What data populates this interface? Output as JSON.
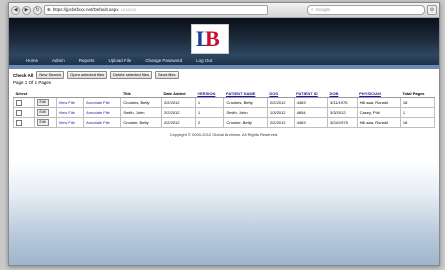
{
  "browser": {
    "url": "https://jpcbkfxxx.net/Default.aspx",
    "url_suffix": "Lexicon",
    "search_placeholder": "Google",
    "nav_back": "◀",
    "nav_forward": "▶",
    "nav_reload": "↻"
  },
  "brand": {
    "logo_letter_1": "L",
    "logo_letter_2": "B"
  },
  "menu": [
    "Home",
    "Admin",
    "Reports",
    "Upload File",
    "Change Password",
    "Log Out"
  ],
  "toolbar": {
    "check_all": "Check All",
    "new_search": "New Search",
    "open_selected": "Open selected files",
    "delete_selected": "Delete selected files",
    "send_files": "Send files"
  },
  "pagination": {
    "page_label": "Page",
    "current": "1",
    "of_label": "Of",
    "total": "1",
    "pages_label": "Pages"
  },
  "table": {
    "columns": [
      "Select",
      "",
      "",
      "",
      "Title",
      "Date Added",
      "VERSION",
      "PATIENT NAME",
      "DOS",
      "PATIENT ID",
      "DOB",
      "PHYSICIAN",
      "Total Pages"
    ],
    "link_columns": [
      6,
      7,
      8,
      9,
      10,
      11
    ],
    "rows": [
      {
        "edit": "Edit",
        "view": "View File",
        "annotate": "Annotate File",
        "title": "Crookes, Betty",
        "date_added": "2/2/2012",
        "version": "1",
        "patient_name": "Crookes, Betty",
        "dos": "2/2/2012",
        "patient_id": "4463",
        "dob": "3/11/1975",
        "physician": "Hill aaa, Ronald",
        "pages": "18"
      },
      {
        "edit": "Edit",
        "view": "View File",
        "annotate": "Annotate File",
        "title": "Smith, John",
        "date_added": "2/2/2012",
        "version": "1",
        "patient_name": "Smith, John",
        "dos": "1/3/2012",
        "patient_id": "4654",
        "dob": "3/3/2012",
        "physician": "Casey, Phil",
        "pages": "1"
      },
      {
        "edit": "Edit",
        "view": "View File",
        "annotate": "Annotate File",
        "title": "Crooker, Betty",
        "date_added": "2/2/2012",
        "version": "2",
        "patient_name": "Crooker, Betty",
        "dos": "2/2/2012",
        "patient_id": "4463",
        "dob": "3/24/1975",
        "physician": "Hill aaa, Ronald",
        "pages": "18"
      }
    ]
  },
  "footer": {
    "copyright": "Copyright © 2000-2012 Global Archives. All Rights Reserved."
  },
  "colors": {
    "header_dark": "#0a0f18",
    "menu": "#2e4862",
    "link": "#1a1aa6",
    "logo_blue": "#1a3f9a",
    "logo_red": "#c8102e"
  }
}
